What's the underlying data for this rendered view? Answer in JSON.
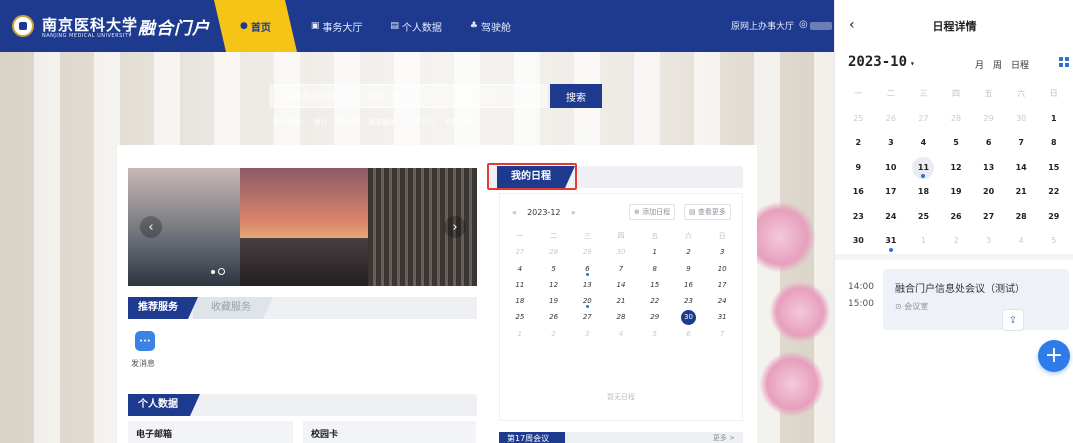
{
  "header": {
    "logo_cn": "南京医科大学",
    "logo_en": "NANJING MEDICAL UNIVERSITY",
    "portal_name": "融合门户",
    "nav": [
      {
        "label": "首页",
        "icon": "home-icon",
        "glyph": "●"
      },
      {
        "label": "事务大厅",
        "icon": "hall-icon",
        "glyph": "▣"
      },
      {
        "label": "个人数据",
        "icon": "data-icon",
        "glyph": "▤"
      },
      {
        "label": "驾驶舱",
        "icon": "cockpit-icon",
        "glyph": "♣"
      }
    ],
    "online_hall": "原网上办事大厅",
    "user_icon": "user-icon",
    "user_glyph": "◎"
  },
  "search": {
    "placeholder": "总部化项目立项、申报、验收、资助",
    "button": "搜索",
    "history_label": "历史搜索:",
    "history": [
      "银行",
      "图书馆",
      "报名服务",
      "任务中心",
      "采购管理"
    ]
  },
  "carousel": {
    "prev": "‹",
    "next": "›"
  },
  "services": {
    "tabs": [
      "推荐服务",
      "收藏服务"
    ],
    "items": [
      {
        "label": "发消息",
        "icon": "message-icon",
        "glyph": "···"
      }
    ]
  },
  "personal": {
    "tab": "个人数据",
    "cards": [
      "电子邮箱",
      "校园卡"
    ]
  },
  "my_schedule": {
    "tab": "我的日程",
    "prev": "«",
    "next": "»",
    "month": "2023-12",
    "add_button": "⊕ 添加日程",
    "more_button": "▤ 查看更多",
    "weekdays": [
      "一",
      "二",
      "三",
      "四",
      "五",
      "六",
      "日"
    ],
    "weeks": [
      [
        "27",
        "28",
        "29",
        "30",
        "1",
        "2",
        "3"
      ],
      [
        "4",
        "5",
        "6",
        "7",
        "8",
        "9",
        "10"
      ],
      [
        "11",
        "12",
        "13",
        "14",
        "15",
        "16",
        "17"
      ],
      [
        "18",
        "19",
        "20",
        "21",
        "22",
        "23",
        "24"
      ],
      [
        "25",
        "26",
        "27",
        "28",
        "29",
        "30",
        "31"
      ],
      [
        "1",
        "2",
        "3",
        "4",
        "5",
        "6",
        "7"
      ]
    ],
    "empty": "暂无日程"
  },
  "meetings": {
    "tab": "第17周会议",
    "more": "更多 >"
  },
  "panel": {
    "back": "‹",
    "title": "日程详情",
    "month": "2023-10",
    "caret": "▾",
    "views": [
      "月",
      "周",
      "日程"
    ],
    "weekdays": [
      "一",
      "二",
      "三",
      "四",
      "五",
      "六",
      "日"
    ],
    "weeks": [
      [
        "25",
        "26",
        "27",
        "28",
        "29",
        "30",
        "1"
      ],
      [
        "2",
        "3",
        "4",
        "5",
        "6",
        "7",
        "8"
      ],
      [
        "9",
        "10",
        "11",
        "12",
        "13",
        "14",
        "15"
      ],
      [
        "16",
        "17",
        "18",
        "19",
        "20",
        "21",
        "22"
      ],
      [
        "23",
        "24",
        "25",
        "26",
        "27",
        "28",
        "29"
      ],
      [
        "30",
        "31",
        "1",
        "2",
        "3",
        "4",
        "5"
      ]
    ],
    "event": {
      "start": "14:00",
      "end": "15:00",
      "title": "融合门户信息处会议（测试）",
      "location": "⊙ 会议室"
    },
    "add": "+",
    "event_btn": "⇪"
  },
  "colors": {
    "brand": "#1d3a8f",
    "accent": "#f6c417",
    "highlight": "#e53935",
    "fab": "#2f7be9"
  }
}
